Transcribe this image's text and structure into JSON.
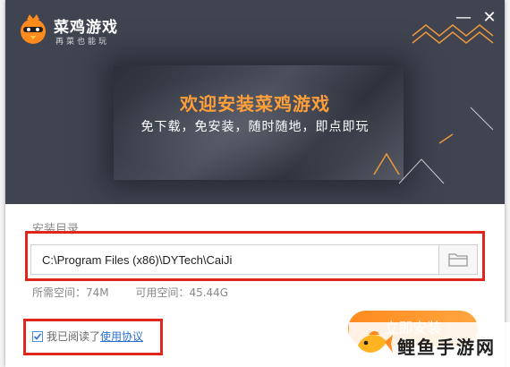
{
  "app": {
    "title": "菜鸡游戏",
    "tagline": "再菜也能玩",
    "minimize_label": "—",
    "close_label": "✕"
  },
  "hero": {
    "title": "欢迎安装菜鸡游戏",
    "subtitle": "免下载，免安装，随时随地，即点即玩"
  },
  "install": {
    "dir_label": "安装目录",
    "dir_value": "C:\\Program Files (x86)\\DYTech\\CaiJi",
    "required_space": "所需空间：74M",
    "available_space": "可用空间：45.44G",
    "button_label": "立即安装"
  },
  "agreement": {
    "checked": true,
    "text": "我已阅读了",
    "link": "使用协议"
  },
  "watermark": {
    "text": "鲤鱼手游网"
  },
  "colors": {
    "accent": "#ff9f3a",
    "hero_bg": "#404451",
    "link": "#2a6fd6",
    "highlight_box": "#e0251d"
  },
  "icons": [
    "chick-logo-icon",
    "folder-icon",
    "checkmark-icon",
    "carp-fish-icon"
  ]
}
